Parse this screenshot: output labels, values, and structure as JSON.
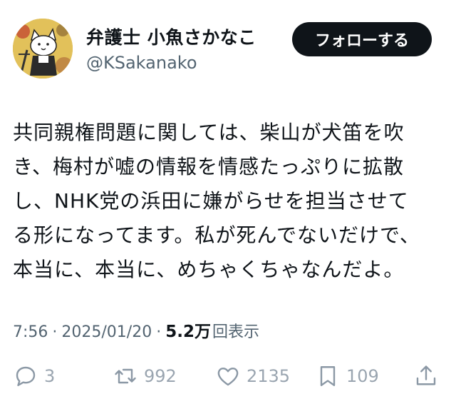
{
  "author": {
    "display_name": "弁護士 小魚さかなこ",
    "handle": "@KSakanako"
  },
  "follow_button_label": "フォローする",
  "tweet": {
    "lines": [
      "共同親権問題に関しては、柴山が犬笛を吹",
      "き、梅村が嘘の情報を情感たっぷりに拡散",
      "し、NHK党の浜田に嫌がらせを担当させて",
      "る形になってます。私が死んでないだけで、",
      "本当に、本当に、めちゃくちゃなんだよ。"
    ]
  },
  "meta": {
    "time": "7:56",
    "separator": "·",
    "date": "2025/01/20",
    "views_count": "5.2万",
    "views_label": "回表示"
  },
  "actions": {
    "reply": {
      "icon": "reply-icon",
      "count": "3"
    },
    "retweet": {
      "icon": "retweet-icon",
      "count": "992"
    },
    "like": {
      "icon": "heart-icon",
      "count": "2135"
    },
    "bookmark": {
      "icon": "bookmark-icon",
      "count": "109"
    },
    "share": {
      "icon": "share-icon"
    }
  },
  "colors": {
    "text": "#0f1419",
    "secondary": "#536471",
    "icon": "#8b98a5",
    "button_bg": "#0f1419"
  }
}
